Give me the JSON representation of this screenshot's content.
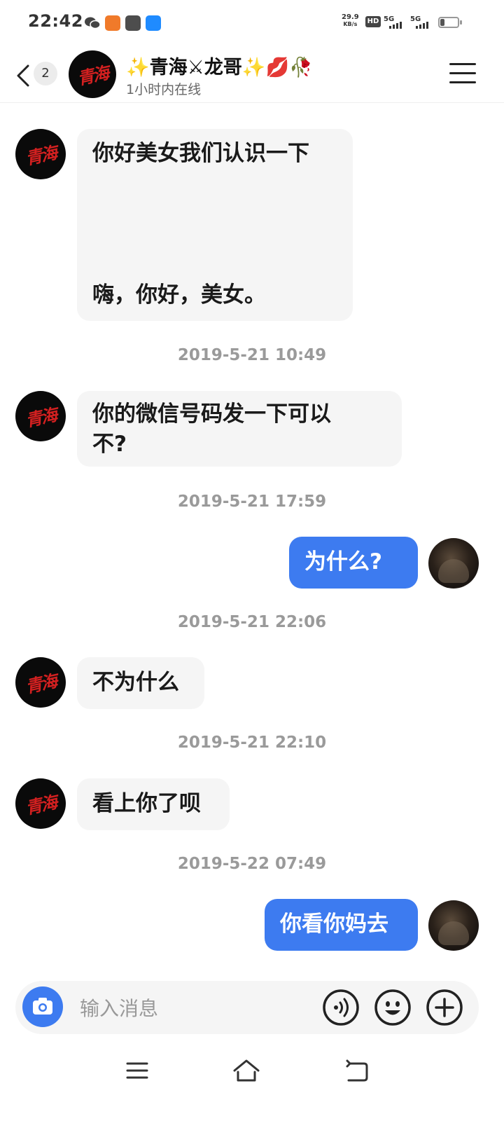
{
  "status_bar": {
    "time": "22:42",
    "net_speed_value": "29.9",
    "net_speed_unit": "KB/s",
    "hd_label": "HD",
    "sim1_label": "5G",
    "sim2_label": "5G",
    "battery_level": 0.25
  },
  "header": {
    "back_badge": "2",
    "avatar_text": "青海",
    "contact_name": "✨青海⚔龙哥✨💋🥀",
    "contact_status": "1小时内在线"
  },
  "messages": [
    {
      "type": "in",
      "lines": [
        "你好美女我们认识一下",
        "嗨，你好，美女。"
      ]
    },
    {
      "type": "timestamp",
      "text": "2019-5-21 10:49"
    },
    {
      "type": "in",
      "lines": [
        "你的微信号码发一下可以",
        "不?"
      ]
    },
    {
      "type": "timestamp",
      "text": "2019-5-21 17:59"
    },
    {
      "type": "out",
      "text": "为什么?"
    },
    {
      "type": "timestamp",
      "text": "2019-5-21 22:06"
    },
    {
      "type": "in",
      "lines": [
        "不为什么"
      ]
    },
    {
      "type": "timestamp",
      "text": "2019-5-21 22:10"
    },
    {
      "type": "in",
      "lines": [
        "看上你了呗"
      ]
    },
    {
      "type": "timestamp",
      "text": "2019-5-22 07:49"
    },
    {
      "type": "out",
      "text": "你看你妈去"
    }
  ],
  "input_bar": {
    "placeholder": "输入消息",
    "icons": [
      "camera-icon",
      "voice-icon",
      "emoji-icon",
      "plus-icon"
    ]
  },
  "nav_bar": {
    "icons": [
      "menu-icon",
      "home-icon",
      "back-icon"
    ]
  },
  "colors": {
    "accent": "#3d7bf0",
    "bubble_in": "#f5f5f5",
    "timestamp": "#9a9a9a"
  }
}
